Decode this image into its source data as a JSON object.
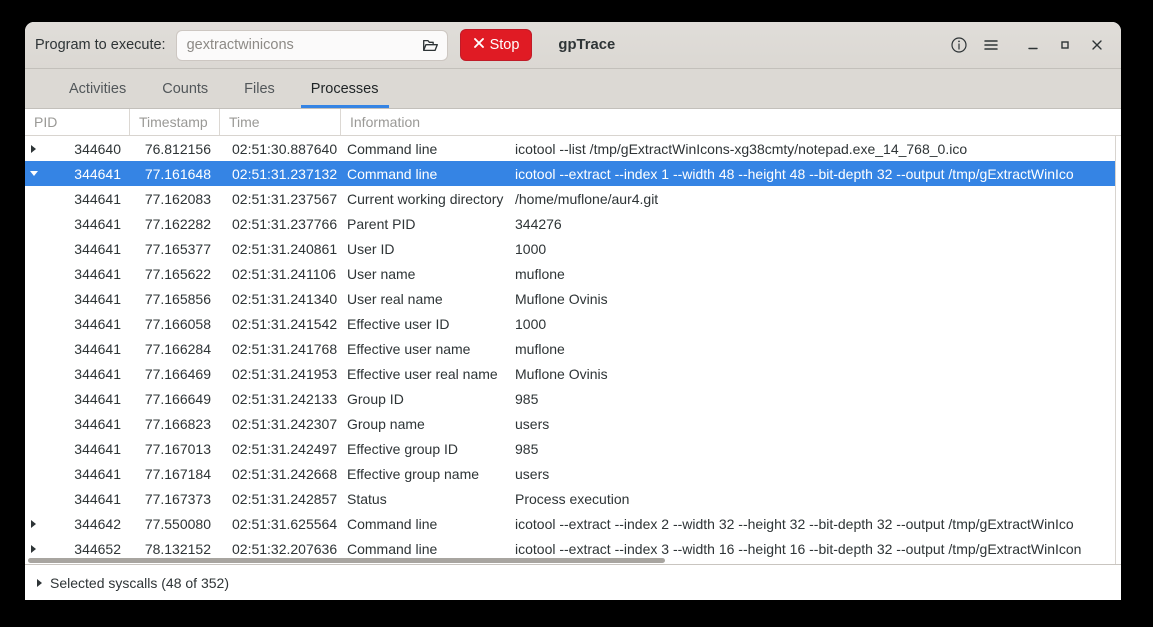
{
  "window": {
    "title": "gpTrace"
  },
  "headerbar": {
    "program_label": "Program to execute:",
    "program_value": "",
    "program_placeholder": "gextractwinicons",
    "open_icon": "folder-open-icon",
    "stop_label": "Stop",
    "stop_icon": "close-x-icon",
    "stop_color": "#e01b24",
    "info_icon": "info-circle-icon",
    "menu_icon": "hamburger-menu-icon",
    "minimize_icon": "minimize-icon",
    "maximize_icon": "maximize-icon",
    "close_icon": "window-close-icon"
  },
  "tabs": [
    {
      "label": "Activities",
      "active": false
    },
    {
      "label": "Counts",
      "active": false
    },
    {
      "label": "Files",
      "active": false
    },
    {
      "label": "Processes",
      "active": true
    }
  ],
  "accent_color": "#3584e4",
  "table": {
    "columns": [
      "PID",
      "Timestamp",
      "Time",
      "Information"
    ],
    "rows": [
      {
        "expander": "right",
        "pid": "344640",
        "timestamp": "76.812156",
        "time": "02:51:30.887640",
        "key": "Command line",
        "value": "icotool --list /tmp/gExtractWinIcons-xg38cmty/notepad.exe_14_768_0.ico",
        "selected": false
      },
      {
        "expander": "down",
        "pid": "344641",
        "timestamp": "77.161648",
        "time": "02:51:31.237132",
        "key": "Command line",
        "value": "icotool --extract --index 1 --width 48 --height 48 --bit-depth 32 --output /tmp/gExtractWinIco",
        "selected": true
      },
      {
        "expander": "none",
        "pid": "344641",
        "timestamp": "77.162083",
        "time": "02:51:31.237567",
        "key": "Current working directory",
        "value": "/home/muflone/aur4.git",
        "selected": false
      },
      {
        "expander": "none",
        "pid": "344641",
        "timestamp": "77.162282",
        "time": "02:51:31.237766",
        "key": "Parent PID",
        "value": "344276",
        "selected": false
      },
      {
        "expander": "none",
        "pid": "344641",
        "timestamp": "77.165377",
        "time": "02:51:31.240861",
        "key": "User ID",
        "value": "1000",
        "selected": false
      },
      {
        "expander": "none",
        "pid": "344641",
        "timestamp": "77.165622",
        "time": "02:51:31.241106",
        "key": "User name",
        "value": "muflone",
        "selected": false
      },
      {
        "expander": "none",
        "pid": "344641",
        "timestamp": "77.165856",
        "time": "02:51:31.241340",
        "key": "User real name",
        "value": "Muflone Ovinis",
        "selected": false
      },
      {
        "expander": "none",
        "pid": "344641",
        "timestamp": "77.166058",
        "time": "02:51:31.241542",
        "key": "Effective user ID",
        "value": "1000",
        "selected": false
      },
      {
        "expander": "none",
        "pid": "344641",
        "timestamp": "77.166284",
        "time": "02:51:31.241768",
        "key": "Effective user name",
        "value": "muflone",
        "selected": false
      },
      {
        "expander": "none",
        "pid": "344641",
        "timestamp": "77.166469",
        "time": "02:51:31.241953",
        "key": "Effective user real name",
        "value": "Muflone Ovinis",
        "selected": false
      },
      {
        "expander": "none",
        "pid": "344641",
        "timestamp": "77.166649",
        "time": "02:51:31.242133",
        "key": "Group ID",
        "value": "985",
        "selected": false
      },
      {
        "expander": "none",
        "pid": "344641",
        "timestamp": "77.166823",
        "time": "02:51:31.242307",
        "key": "Group name",
        "value": "users",
        "selected": false
      },
      {
        "expander": "none",
        "pid": "344641",
        "timestamp": "77.167013",
        "time": "02:51:31.242497",
        "key": "Effective group ID",
        "value": "985",
        "selected": false
      },
      {
        "expander": "none",
        "pid": "344641",
        "timestamp": "77.167184",
        "time": "02:51:31.242668",
        "key": "Effective group name",
        "value": "users",
        "selected": false
      },
      {
        "expander": "none",
        "pid": "344641",
        "timestamp": "77.167373",
        "time": "02:51:31.242857",
        "key": "Status",
        "value": "Process execution",
        "selected": false
      },
      {
        "expander": "right",
        "pid": "344642",
        "timestamp": "77.550080",
        "time": "02:51:31.625564",
        "key": "Command line",
        "value": "icotool --extract --index 2 --width 32 --height 32 --bit-depth 32 --output /tmp/gExtractWinIco",
        "selected": false
      },
      {
        "expander": "right",
        "pid": "344652",
        "timestamp": "78.132152",
        "time": "02:51:32.207636",
        "key": "Command line",
        "value": "icotool --extract --index 3 --width 16 --height 16 --bit-depth 32 --output /tmp/gExtractWinIcon",
        "selected": false
      }
    ]
  },
  "statusbar": {
    "label": "Selected syscalls (48 of 352)",
    "expander_icon": "chevron-right-icon"
  }
}
